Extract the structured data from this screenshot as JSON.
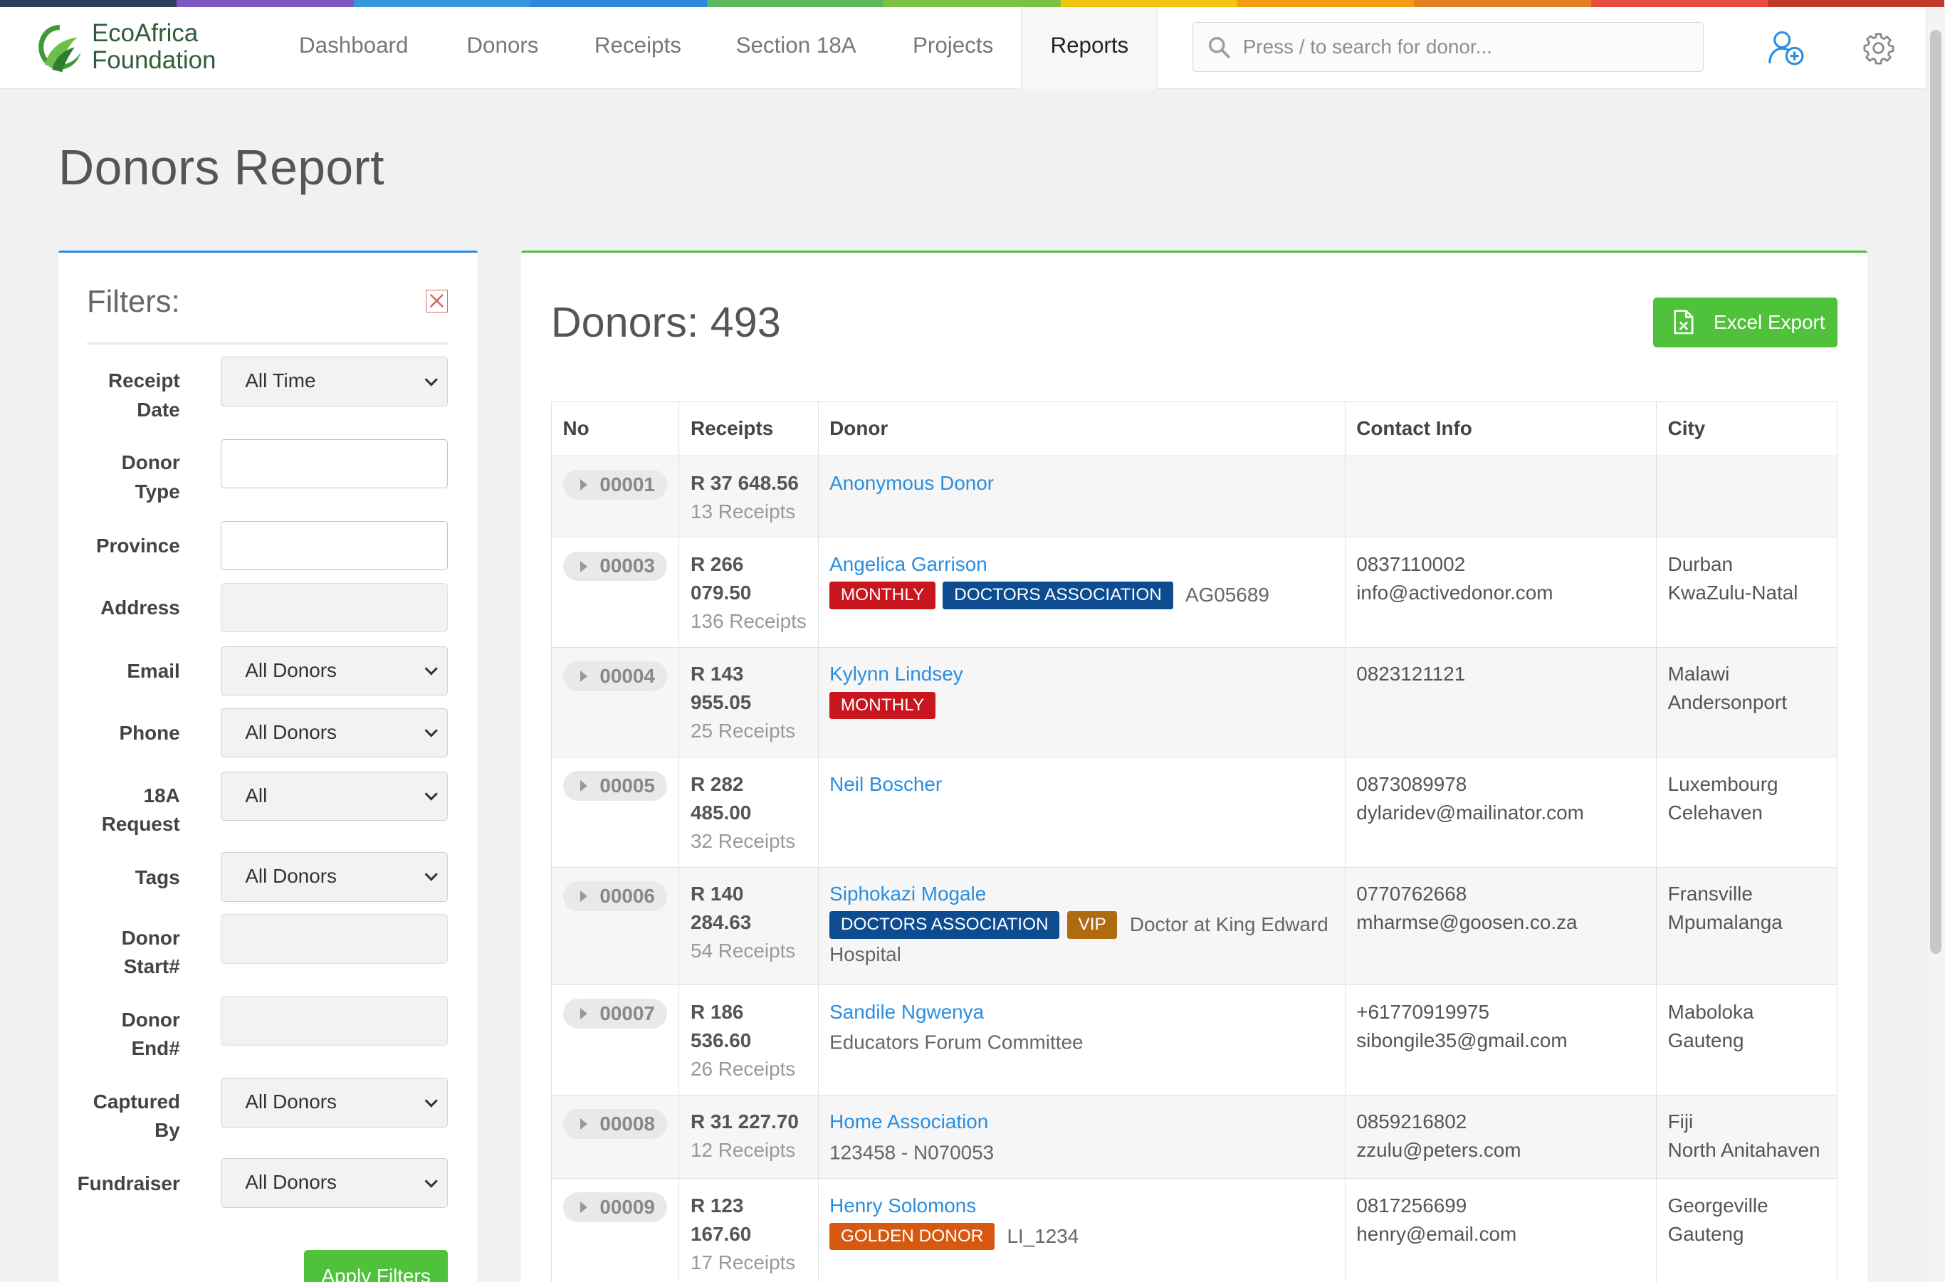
{
  "colors": {
    "rainbow": [
      "#2e3f5c",
      "#7e57c2",
      "#3498db",
      "#2e86de",
      "#5cb85c",
      "#7cc142",
      "#f1c40f",
      "#f39c12",
      "#e67e22",
      "#e74c3c",
      "#c0392b"
    ],
    "accent_green": "#4fc13a",
    "accent_blue": "#2a8ee0",
    "badge_monthly": "#c9151e",
    "badge_doctors": "#0e4c92",
    "badge_vip": "#b06a10",
    "badge_golden": "#d9580f"
  },
  "brand": {
    "line1": "EcoAfrica",
    "line2": "Foundation"
  },
  "nav": [
    {
      "label": "Dashboard"
    },
    {
      "label": "Donors"
    },
    {
      "label": "Receipts"
    },
    {
      "label": "Section 18A"
    },
    {
      "label": "Projects"
    },
    {
      "label": "Reports",
      "active": true
    }
  ],
  "search": {
    "placeholder": "Press / to search for donor..."
  },
  "page_title": "Donors Report",
  "filters": {
    "title": "Filters:",
    "fields": [
      {
        "label": "Receipt Date",
        "type": "select",
        "value": "All Time"
      },
      {
        "label": "Donor Type",
        "type": "text",
        "value": ""
      },
      {
        "label": "Province",
        "type": "text",
        "value": ""
      },
      {
        "label": "Address",
        "type": "text-grey",
        "value": ""
      },
      {
        "label": "Email",
        "type": "select",
        "value": "All Donors"
      },
      {
        "label": "Phone",
        "type": "select",
        "value": "All Donors"
      },
      {
        "label": "18A Request",
        "type": "select",
        "value": "All"
      },
      {
        "label": "Tags",
        "type": "select",
        "value": "All Donors"
      },
      {
        "label": "Donor Start#",
        "type": "text-grey",
        "value": ""
      },
      {
        "label": "Donor End#",
        "type": "text-grey",
        "value": ""
      },
      {
        "label": "Captured By",
        "type": "select",
        "value": "All Donors"
      },
      {
        "label": "Fundraiser",
        "type": "select",
        "value": "All Donors"
      }
    ],
    "apply_label": "Apply Filters"
  },
  "report": {
    "count_label": "Donors: 493",
    "export_label": "Excel Export",
    "columns": [
      "No",
      "Receipts",
      "Donor",
      "Contact Info",
      "City"
    ],
    "rows": [
      {
        "no": "00001",
        "amount": "R 37 648.56",
        "receipts": "13 Receipts",
        "donor": "Anonymous Donor",
        "tags": [],
        "extra": "",
        "contact": [],
        "city": []
      },
      {
        "no": "00003",
        "amount": "R 266 079.50",
        "receipts": "136 Receipts",
        "donor": "Angelica Garrison",
        "tags": [
          "MONTHLY",
          "DOCTORS ASSOCIATION"
        ],
        "extra": "AG05689",
        "contact": [
          "0837110002",
          "info@activedonor.com"
        ],
        "city": [
          "Durban",
          "KwaZulu-Natal"
        ]
      },
      {
        "no": "00004",
        "amount": "R 143 955.05",
        "receipts": "25 Receipts",
        "donor": "Kylynn Lindsey",
        "tags": [
          "MONTHLY"
        ],
        "extra": "",
        "contact": [
          "0823121121"
        ],
        "city": [
          "Malawi",
          "Andersonport"
        ]
      },
      {
        "no": "00005",
        "amount": "R 282 485.00",
        "receipts": "32 Receipts",
        "donor": "Neil Boscher",
        "tags": [],
        "extra": "",
        "contact": [
          "0873089978",
          "dylaridev@mailinator.com"
        ],
        "city": [
          "Luxembourg",
          "Celehaven"
        ]
      },
      {
        "no": "00006",
        "amount": "R 140 284.63",
        "receipts": "54 Receipts",
        "donor": "Siphokazi Mogale",
        "tags": [
          "DOCTORS ASSOCIATION",
          "VIP"
        ],
        "extra": "Doctor at King Edward Hospital",
        "contact": [
          "0770762668",
          "mharmse@goosen.co.za"
        ],
        "city": [
          "Fransville",
          "Mpumalanga"
        ]
      },
      {
        "no": "00007",
        "amount": "R 186 536.60",
        "receipts": "26 Receipts",
        "donor": "Sandile Ngwenya",
        "tags": [],
        "extra": "Educators Forum Committee",
        "contact": [
          "+61770919975",
          "sibongile35@gmail.com"
        ],
        "city": [
          "Maboloka",
          "Gauteng"
        ]
      },
      {
        "no": "00008",
        "amount": "R 31 227.70",
        "receipts": "12 Receipts",
        "donor": "Home Association",
        "tags": [],
        "extra": "123458 - N070053",
        "contact": [
          "0859216802",
          "zzulu@peters.com"
        ],
        "city": [
          "Fiji",
          "North Anitahaven"
        ]
      },
      {
        "no": "00009",
        "amount": "R 123 167.60",
        "receipts": "17 Receipts",
        "donor": "Henry Solomons",
        "tags": [
          "GOLDEN DONOR"
        ],
        "extra": "LI_1234",
        "contact": [
          "0817256699",
          "henry@email.com"
        ],
        "city": [
          "Georgeville",
          "Gauteng"
        ]
      }
    ]
  }
}
